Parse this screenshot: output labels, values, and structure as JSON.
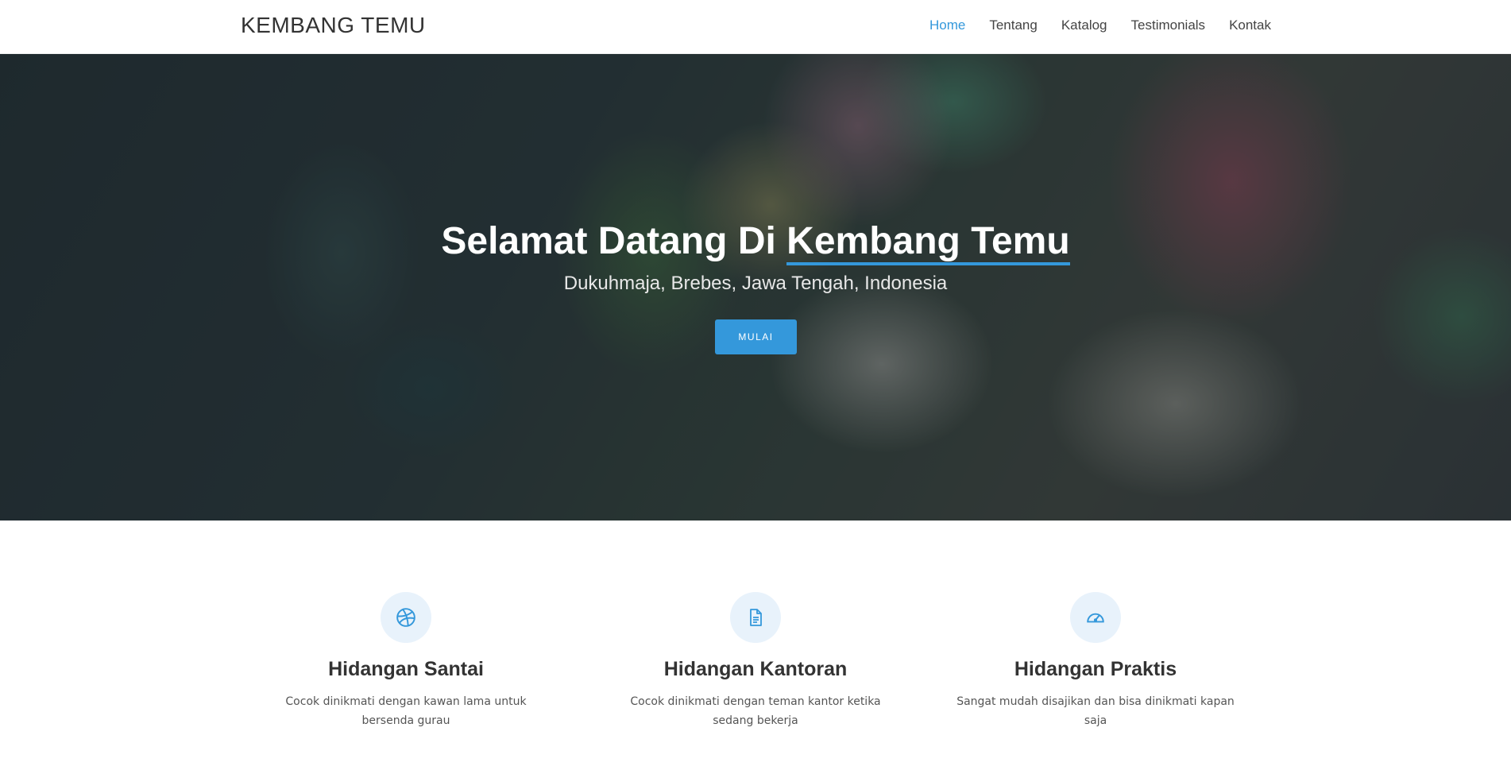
{
  "header": {
    "brand": "KEMBANG TEMU",
    "nav": [
      {
        "label": "Home",
        "active": true
      },
      {
        "label": "Tentang",
        "active": false
      },
      {
        "label": "Katalog",
        "active": false
      },
      {
        "label": "Testimonials",
        "active": false
      },
      {
        "label": "Kontak",
        "active": false
      }
    ]
  },
  "hero": {
    "title_prefix": "Selamat Datang Di ",
    "title_highlight": "Kembang Temu",
    "subtitle": "Dukuhmaja, Brebes, Jawa Tengah, Indonesia",
    "button_label": "MULAI"
  },
  "features": [
    {
      "icon": "dribbble-icon",
      "title": "Hidangan Santai",
      "text": "Cocok dinikmati dengan kawan lama untuk bersenda gurau"
    },
    {
      "icon": "document-icon",
      "title": "Hidangan Kantoran",
      "text": "Cocok dinikmati dengan teman kantor ketika sedang bekerja"
    },
    {
      "icon": "speedometer-icon",
      "title": "Hidangan Praktis",
      "text": "Sangat mudah disajikan dan bisa dinikmati kapan saja"
    }
  ],
  "colors": {
    "accent": "#3498db",
    "icon_bg": "#e8f2fb"
  }
}
